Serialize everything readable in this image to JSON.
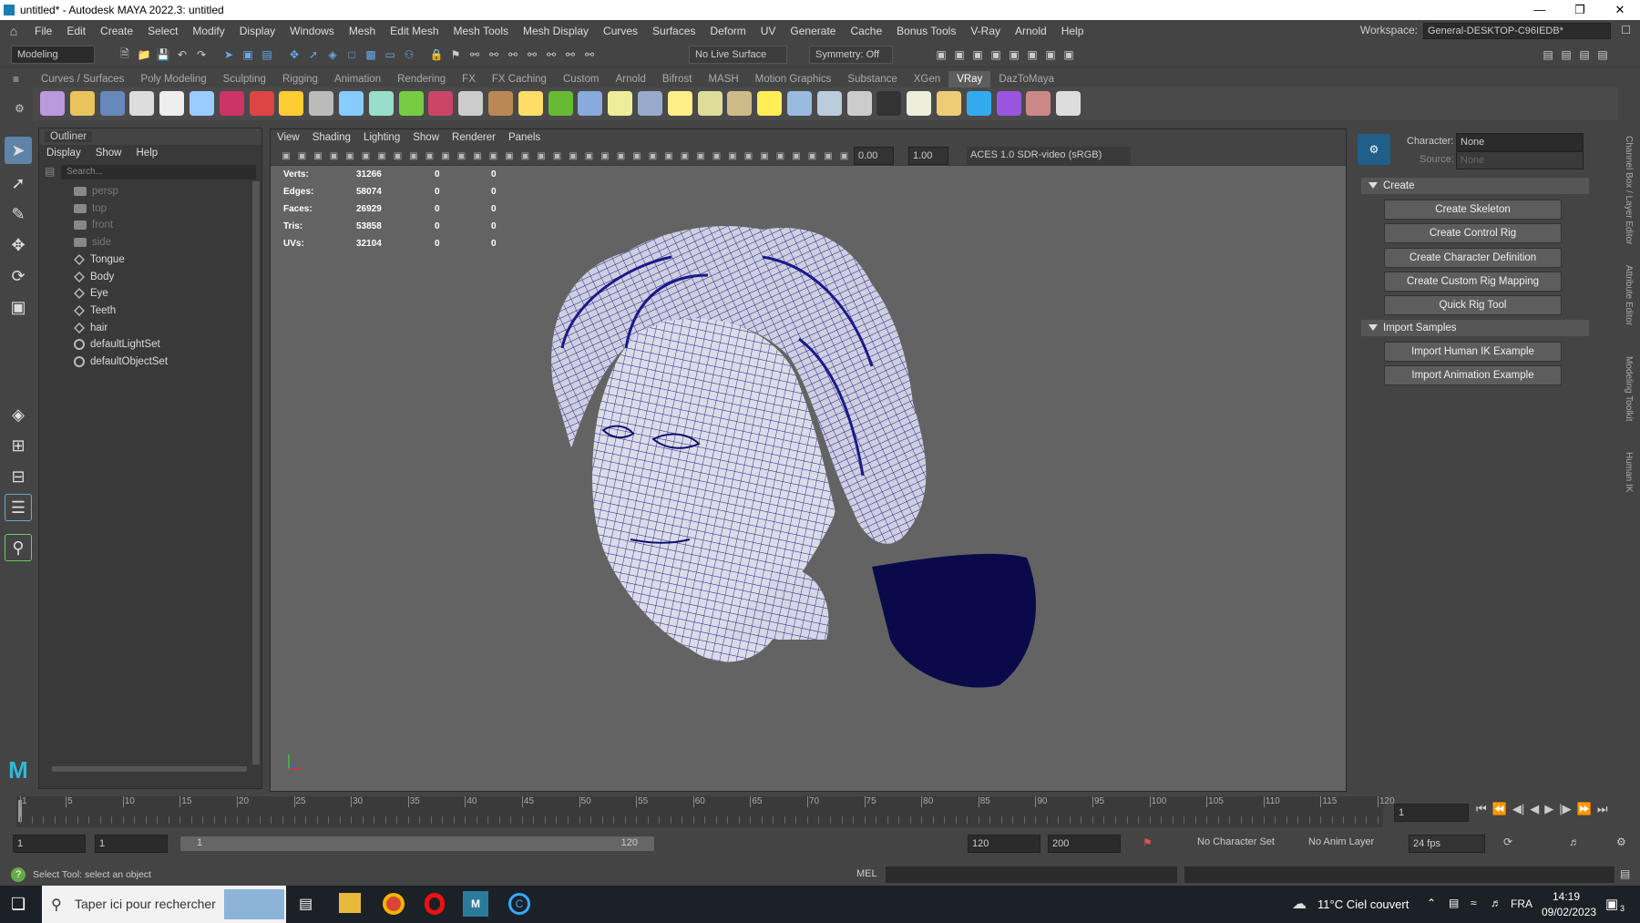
{
  "window": {
    "title": "untitled* - Autodesk MAYA 2022.3: untitled"
  },
  "menus": [
    "File",
    "Edit",
    "Create",
    "Select",
    "Modify",
    "Display",
    "Windows",
    "Mesh",
    "Edit Mesh",
    "Mesh Tools",
    "Mesh Display",
    "Curves",
    "Surfaces",
    "Deform",
    "UV",
    "Generate",
    "Cache",
    "Bonus Tools",
    "V-Ray",
    "Arnold",
    "Help"
  ],
  "workspace": {
    "label": "Workspace:",
    "value": "General-DESKTOP-C96IEDB*"
  },
  "status_line": {
    "mode": "Modeling",
    "live_surface": "No Live Surface",
    "symmetry": "Symmetry: Off"
  },
  "shelf_tabs": [
    "Curves / Surfaces",
    "Poly Modeling",
    "Sculpting",
    "Rigging",
    "Animation",
    "Rendering",
    "FX",
    "FX Caching",
    "Custom",
    "Arnold",
    "Bifrost",
    "MASH",
    "Motion Graphics",
    "Substance",
    "XGen",
    "VRay",
    "DazToMaya"
  ],
  "shelf_active": "VRay",
  "outliner": {
    "title": "Outliner",
    "menu": [
      "Display",
      "Show",
      "Help"
    ],
    "search_placeholder": "Search...",
    "items": [
      {
        "label": "persp",
        "kind": "camera",
        "dim": true
      },
      {
        "label": "top",
        "kind": "camera",
        "dim": true
      },
      {
        "label": "front",
        "kind": "camera",
        "dim": true
      },
      {
        "label": "side",
        "kind": "camera",
        "dim": true
      },
      {
        "label": "Tongue",
        "kind": "mesh",
        "dim": false
      },
      {
        "label": "Body",
        "kind": "mesh",
        "dim": false
      },
      {
        "label": "Eye",
        "kind": "mesh",
        "dim": false
      },
      {
        "label": "Teeth",
        "kind": "mesh",
        "dim": false
      },
      {
        "label": "hair",
        "kind": "mesh",
        "dim": false
      },
      {
        "label": "defaultLightSet",
        "kind": "set",
        "dim": false
      },
      {
        "label": "defaultObjectSet",
        "kind": "set",
        "dim": false
      }
    ]
  },
  "viewport": {
    "menu": [
      "View",
      "Shading",
      "Lighting",
      "Show",
      "Renderer",
      "Panels"
    ],
    "field1": "0.00",
    "field2": "1.00",
    "colorspace": "ACES 1.0 SDR-video (sRGB)",
    "hud": [
      {
        "label": "Verts:",
        "v1": "31266",
        "v2": "0",
        "v3": "0"
      },
      {
        "label": "Edges:",
        "v1": "58074",
        "v2": "0",
        "v3": "0"
      },
      {
        "label": "Faces:",
        "v1": "26929",
        "v2": "0",
        "v3": "0"
      },
      {
        "label": "Tris:",
        "v1": "53858",
        "v2": "0",
        "v3": "0"
      },
      {
        "label": "UVs:",
        "v1": "32104",
        "v2": "0",
        "v3": "0"
      }
    ]
  },
  "hik": {
    "character_label": "Character:",
    "character_value": "None",
    "source_label": "Source:",
    "source_value": "None",
    "section_create": "Create",
    "create_buttons": [
      "Create Skeleton",
      "Create Control Rig",
      "Create Character Definition",
      "Create Custom Rig Mapping",
      "Quick Rig Tool"
    ],
    "section_import": "Import Samples",
    "import_buttons": [
      "Import Human IK Example",
      "Import Animation Example"
    ]
  },
  "side_tabs": [
    "Channel Box / Layer Editor",
    "Attribute Editor",
    "Modeling Toolkit",
    "Human IK"
  ],
  "timeline": {
    "ticks": [
      "1",
      "5",
      "10",
      "15",
      "20",
      "25",
      "30",
      "35",
      "40",
      "45",
      "50",
      "55",
      "60",
      "65",
      "70",
      "75",
      "80",
      "85",
      "90",
      "95",
      "100",
      "105",
      "110",
      "115",
      "120"
    ],
    "current_frame": "1"
  },
  "range": {
    "start": "1",
    "start2": "1",
    "slider_start": "1",
    "slider_end": "120",
    "end": "120",
    "end2": "200",
    "char_set": "No Character Set",
    "anim_layer": "No Anim Layer",
    "fps": "24 fps"
  },
  "helpline": {
    "text": "Select Tool: select an object",
    "mel": "MEL"
  },
  "taskbar": {
    "search": "Taper ici pour rechercher",
    "weather": "11°C  Ciel couvert",
    "lang": "FRA",
    "time": "14:19",
    "date": "09/02/2023",
    "notif": "3"
  }
}
